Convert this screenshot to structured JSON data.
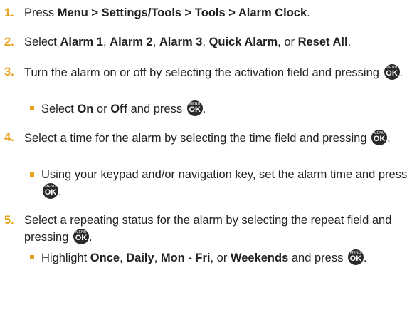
{
  "accent_color": "#e8a21c",
  "key_icon": {
    "name": "menu-ok-key-icon",
    "top": "MENU",
    "main": "OK"
  },
  "steps": [
    {
      "num": "1.",
      "t0": "Press ",
      "b0": "Menu > Settings/Tools > Tools > Alarm Clock",
      "t1": "."
    },
    {
      "num": "2.",
      "t0": "Select ",
      "b0": "Alarm 1",
      "t1": ", ",
      "b1": "Alarm 2",
      "t2": ", ",
      "b2": "Alarm 3",
      "t3": ", ",
      "b3": "Quick Alarm",
      "t4": ", or ",
      "b4": "Reset All",
      "t5": "."
    },
    {
      "num": "3.",
      "t0": "Turn the alarm on or off by selecting the activation field and pressing ",
      "t1": ".",
      "sub": {
        "t0": "Select ",
        "b0": "On",
        "t1": " or ",
        "b1": "Off",
        "t2": " and press ",
        "t3": "."
      }
    },
    {
      "num": "4.",
      "t0": "Select a time for the alarm by selecting the time field and pressing ",
      "t1": ".",
      "sub": {
        "t0": "Using your keypad and/or navigation key, set the alarm time and press ",
        "t1": "."
      }
    },
    {
      "num": "5.",
      "t0": "Select a repeating status for the alarm by selecting the repeat field and pressing ",
      "t1": ".",
      "sub": {
        "t0": "Highlight ",
        "b0": "Once",
        "t1": ", ",
        "b1": "Daily",
        "t2": ", ",
        "b2": "Mon - Fri",
        "t3": ", or ",
        "b3": "Weekends",
        "t4": " and press ",
        "t5": "."
      }
    }
  ]
}
